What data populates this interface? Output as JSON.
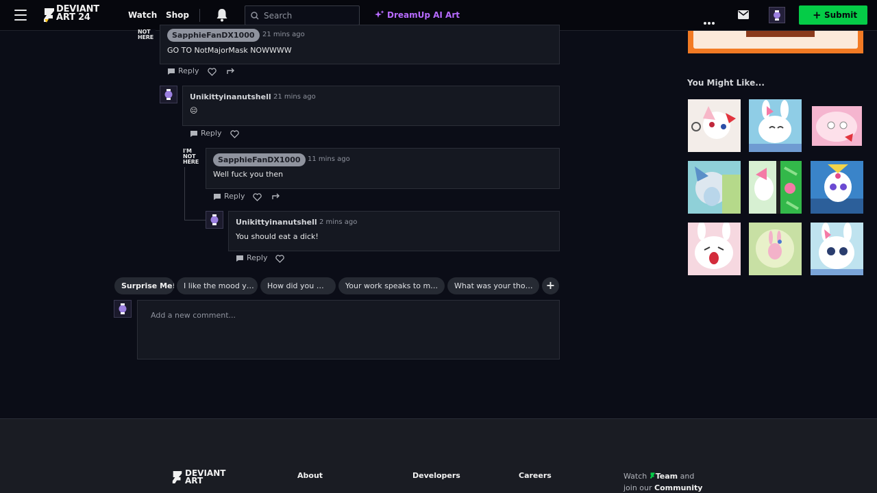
{
  "header": {
    "logo_line1": "DEVIANT",
    "logo_line2": "ART 24",
    "nav": {
      "watch": "Watch",
      "shop": "Shop"
    },
    "search_placeholder": "Search",
    "dreamup": "DreamUp AI Art",
    "submit": "Submit"
  },
  "comments": [
    {
      "username": "SapphieFanDX1000",
      "time": "21 mins ago",
      "text": "GO TO NotMajorMask NOWWWW",
      "avatar_text": [
        "NOT",
        "HERE"
      ],
      "reply_label": "Reply"
    },
    {
      "username": "Unikittyinanutshell",
      "time": "21 mins ago",
      "text": "😑",
      "reply_label": "Reply"
    },
    {
      "username": "SapphieFanDX1000",
      "time": "11 mins ago",
      "text": "Well fuck you then",
      "avatar_text": [
        "I'M",
        "NOT",
        "HERE"
      ],
      "reply_label": "Reply"
    },
    {
      "username": "Unikittyinanutshell",
      "time": "2 mins ago",
      "text": "You should eat a dick!",
      "reply_label": "Reply"
    }
  ],
  "suggestions": [
    "Surprise Me!",
    "I like the mood y…",
    "How did you …",
    "Your work speaks to m…",
    "What was your tho…"
  ],
  "new_comment_placeholder": "Add a new comment...",
  "sidebar": {
    "you_might_like": "You Might Like..."
  },
  "footer": {
    "logo_line1": "DEVIANT",
    "logo_line2": "ART",
    "about": "About",
    "developers": "Developers",
    "careers": "Careers",
    "watch_prefix": "Watch",
    "watch_team": "Team",
    "watch_and": "and",
    "join_prefix": "join our",
    "join_community": "Community"
  },
  "colors": {
    "accent_green": "#05cc47",
    "dreamup_purple": "#b76bff",
    "background": "#0b0d17"
  }
}
